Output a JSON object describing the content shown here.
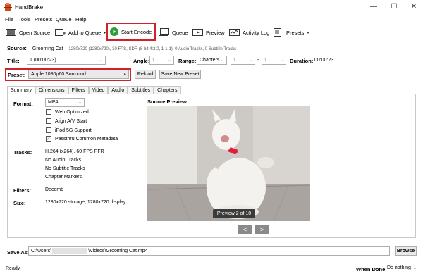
{
  "window": {
    "title": "HandBrake",
    "minimize": "—",
    "maximize": "☐",
    "close": "✕"
  },
  "menu": [
    "File",
    "Tools",
    "Presets",
    "Queue",
    "Help"
  ],
  "toolbar": {
    "open_source": "Open Source",
    "add_to_queue": "Add to Queue",
    "start_encode": "Start Encode",
    "queue": "Queue",
    "preview": "Preview",
    "activity_log": "Activity Log",
    "presets": "Presets"
  },
  "source": {
    "label": "Source:",
    "name": "Grooming Cat",
    "info": "1280x720 (1280x720), 30 FPS, SDR (8-bit 4:2:0, 1-1-1), 0 Audio Tracks, 0 Subtitle Tracks"
  },
  "title_row": {
    "title_label": "Title:",
    "title_value": "1 (00:00:23)",
    "angle_label": "Angle:",
    "angle_value": "1",
    "range_label": "Range:",
    "range_value": "Chapters",
    "range_start": "1",
    "range_sep": "-",
    "range_end": "1",
    "duration_label": "Duration:",
    "duration_value": "00:00:23"
  },
  "preset": {
    "label": "Preset:",
    "value": "Apple 1080p60 Surround",
    "reload": "Reload",
    "save_new": "Save New Preset"
  },
  "tabs": [
    "Summary",
    "Dimensions",
    "Filters",
    "Video",
    "Audio",
    "Subtitles",
    "Chapters"
  ],
  "summary": {
    "format_label": "Format:",
    "format_value": "MP4",
    "options": [
      {
        "label": "Web Optimized",
        "checked": false
      },
      {
        "label": "Align A/V Start",
        "checked": false
      },
      {
        "label": "iPod 5G Support",
        "checked": false
      },
      {
        "label": "Passthru Common Metadata",
        "checked": true
      }
    ],
    "tracks_label": "Tracks:",
    "tracks": [
      "H.264 (x264), 60 FPS PFR",
      "No Audio Tracks",
      "No Subtitle Tracks",
      "Chapter Markers"
    ],
    "filters_label": "Filters:",
    "filters_value": "Decomb",
    "size_label": "Size:",
    "size_value": "1280x720 storage, 1280x720 display",
    "preview_label": "Source Preview:",
    "preview_counter": "Preview 2 of 10",
    "prev_btn": "<",
    "next_btn": ">"
  },
  "save_as": {
    "label": "Save As:",
    "path_prefix": "C:\\Users\\",
    "path_suffix": "\\Videos\\Grooming Cat.mp4",
    "browse": "Browse"
  },
  "status": {
    "text": "Ready",
    "when_done_label": "When Done:",
    "when_done_value": "Do nothing"
  },
  "colors": {
    "highlight": "#d0202a",
    "accent": "#2e9c3b"
  }
}
